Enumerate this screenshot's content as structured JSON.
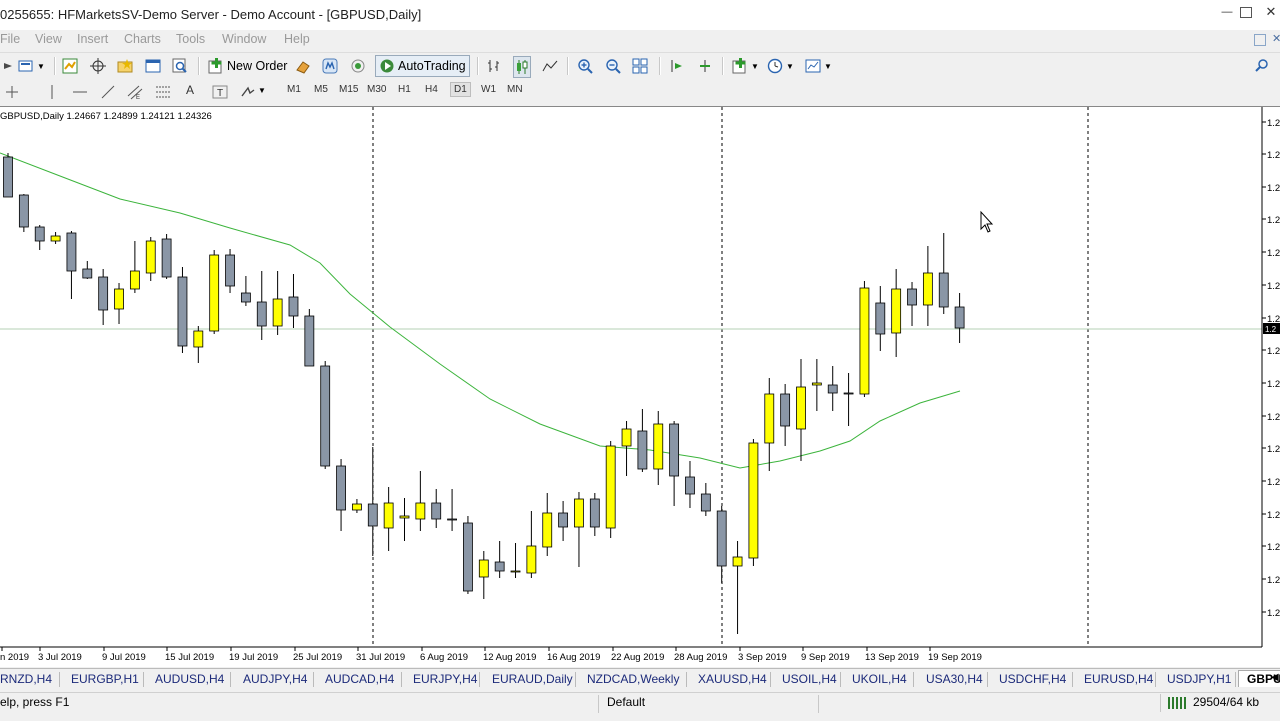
{
  "window": {
    "title": "0255655: HFMarketsSV-Demo Server - Demo Account - [GBPUSD,Daily]"
  },
  "menu": [
    "File",
    "View",
    "Insert",
    "Charts",
    "Tools",
    "Window",
    "Help"
  ],
  "toolbar": {
    "new_order": "New Order",
    "auto_trading": "AutoTrading"
  },
  "timeframes": [
    "M1",
    "M5",
    "M15",
    "M30",
    "H1",
    "H4",
    "D1",
    "W1",
    "MN"
  ],
  "active_timeframe": "D1",
  "chart": {
    "info": "GBPUSD,Daily  1.24667 1.24899 1.24121 1.24326",
    "current_price_label": "1.2"
  },
  "chart_data": {
    "type": "candlestick",
    "symbol": "GBPUSD",
    "timeframe": "Daily",
    "ohlc_last": {
      "open": 1.24667,
      "high": 1.24899,
      "low": 1.24121,
      "close": 1.24326
    },
    "x_tick_labels": [
      "n 2019",
      "3 Jul 2019",
      "9 Jul 2019",
      "15 Jul 2019",
      "19 Jul 2019",
      "25 Jul 2019",
      "31 Jul 2019",
      "6 Aug 2019",
      "12 Aug 2019",
      "16 Aug 2019",
      "22 Aug 2019",
      "28 Aug 2019",
      "3 Sep 2019",
      "9 Sep 2019",
      "13 Sep 2019",
      "19 Sep 2019"
    ],
    "y_tick_labels": [
      "1.2",
      "1.2",
      "1.2",
      "1.2",
      "1.2",
      "1.2",
      "1.2",
      "1.2",
      "1.2",
      "1.2",
      "1.2",
      "1.2",
      "1.2",
      "1.2",
      "1.2",
      "1.2"
    ],
    "colors": {
      "bull": "#ffff00",
      "bear": "#8a96a6",
      "wick": "#000000",
      "ma": "#3cb43c",
      "price_line": "#b4d2b4"
    },
    "candles_pixel_scale": [
      {
        "o": 156,
        "h": 152,
        "l": 196,
        "c": 196
      },
      {
        "o": 194,
        "h": 193,
        "l": 231,
        "c": 226
      },
      {
        "o": 226,
        "h": 224,
        "l": 249,
        "c": 240
      },
      {
        "o": 240,
        "h": 231,
        "l": 243,
        "c": 235
      },
      {
        "o": 232,
        "h": 230,
        "l": 298,
        "c": 270
      },
      {
        "o": 268,
        "h": 260,
        "l": 278,
        "c": 277
      },
      {
        "o": 276,
        "h": 268,
        "l": 324,
        "c": 309
      },
      {
        "o": 308,
        "h": 282,
        "l": 323,
        "c": 288
      },
      {
        "o": 288,
        "h": 240,
        "l": 292,
        "c": 270
      },
      {
        "o": 272,
        "h": 236,
        "l": 280,
        "c": 240
      },
      {
        "o": 238,
        "h": 233,
        "l": 278,
        "c": 276
      },
      {
        "o": 276,
        "h": 266,
        "l": 352,
        "c": 345
      },
      {
        "o": 346,
        "h": 325,
        "l": 362,
        "c": 330
      },
      {
        "o": 330,
        "h": 249,
        "l": 333,
        "c": 254
      },
      {
        "o": 254,
        "h": 248,
        "l": 292,
        "c": 285
      },
      {
        "o": 292,
        "h": 275,
        "l": 305,
        "c": 301
      },
      {
        "o": 301,
        "h": 270,
        "l": 339,
        "c": 325
      },
      {
        "o": 325,
        "h": 270,
        "l": 334,
        "c": 298
      },
      {
        "o": 296,
        "h": 273,
        "l": 327,
        "c": 315
      },
      {
        "o": 315,
        "h": 308,
        "l": 365,
        "c": 365
      },
      {
        "o": 365,
        "h": 360,
        "l": 468,
        "c": 465
      },
      {
        "o": 465,
        "h": 458,
        "l": 530,
        "c": 509
      },
      {
        "o": 509,
        "h": 498,
        "l": 512,
        "c": 503
      },
      {
        "o": 503,
        "h": 446,
        "l": 555,
        "c": 525
      },
      {
        "o": 527,
        "h": 486,
        "l": 550,
        "c": 502
      },
      {
        "o": 517,
        "h": 497,
        "l": 540,
        "c": 515
      },
      {
        "o": 518,
        "h": 470,
        "l": 530,
        "c": 502
      },
      {
        "o": 502,
        "h": 488,
        "l": 527,
        "c": 518
      },
      {
        "o": 518,
        "h": 488,
        "l": 530,
        "c": 519
      },
      {
        "o": 522,
        "h": 515,
        "l": 593,
        "c": 590
      },
      {
        "o": 576,
        "h": 550,
        "l": 598,
        "c": 559
      },
      {
        "o": 561,
        "h": 540,
        "l": 577,
        "c": 570
      },
      {
        "o": 571,
        "h": 542,
        "l": 577,
        "c": 570
      },
      {
        "o": 572,
        "h": 510,
        "l": 577,
        "c": 545
      },
      {
        "o": 546,
        "h": 492,
        "l": 555,
        "c": 512
      },
      {
        "o": 512,
        "h": 500,
        "l": 540,
        "c": 526
      },
      {
        "o": 526,
        "h": 491,
        "l": 566,
        "c": 498
      },
      {
        "o": 498,
        "h": 492,
        "l": 535,
        "c": 526
      },
      {
        "o": 527,
        "h": 440,
        "l": 537,
        "c": 445
      },
      {
        "o": 445,
        "h": 420,
        "l": 475,
        "c": 428
      },
      {
        "o": 430,
        "h": 408,
        "l": 471,
        "c": 468
      },
      {
        "o": 468,
        "h": 410,
        "l": 484,
        "c": 423
      },
      {
        "o": 423,
        "h": 420,
        "l": 505,
        "c": 475
      },
      {
        "o": 476,
        "h": 460,
        "l": 507,
        "c": 493
      },
      {
        "o": 493,
        "h": 482,
        "l": 515,
        "c": 510
      },
      {
        "o": 510,
        "h": 505,
        "l": 582,
        "c": 565
      },
      {
        "o": 565,
        "h": 540,
        "l": 633,
        "c": 556
      },
      {
        "o": 557,
        "h": 438,
        "l": 565,
        "c": 442
      },
      {
        "o": 442,
        "h": 377,
        "l": 470,
        "c": 393
      },
      {
        "o": 393,
        "h": 383,
        "l": 445,
        "c": 425
      },
      {
        "o": 428,
        "h": 358,
        "l": 460,
        "c": 386
      },
      {
        "o": 384,
        "h": 358,
        "l": 410,
        "c": 382
      },
      {
        "o": 384,
        "h": 365,
        "l": 410,
        "c": 392
      },
      {
        "o": 392,
        "h": 372,
        "l": 425,
        "c": 392
      },
      {
        "o": 393,
        "h": 280,
        "l": 396,
        "c": 287
      },
      {
        "o": 302,
        "h": 285,
        "l": 350,
        "c": 333
      },
      {
        "o": 332,
        "h": 268,
        "l": 356,
        "c": 288
      },
      {
        "o": 288,
        "h": 281,
        "l": 325,
        "c": 304
      },
      {
        "o": 304,
        "h": 245,
        "l": 325,
        "c": 272
      },
      {
        "o": 272,
        "h": 232,
        "l": 313,
        "c": 306
      },
      {
        "o": 306,
        "h": 292,
        "l": 342,
        "c": 327
      }
    ]
  },
  "symbol_tabs": [
    "RNZD,H4",
    "EURGBP,H1",
    "AUDUSD,H4",
    "AUDJPY,H4",
    "AUDCAD,H4",
    "EURJPY,H4",
    "EURAUD,Daily",
    "NZDCAD,Weekly",
    "XAUUSD,H4",
    "USOIL,H4",
    "UKOIL,H4",
    "USA30,H4",
    "USDCHF,H4",
    "EURUSD,H4",
    "USDJPY,H1",
    "GBPU"
  ],
  "status": {
    "help": "elp, press F1",
    "profile": "Default",
    "traffic": "29504/64 kb"
  }
}
